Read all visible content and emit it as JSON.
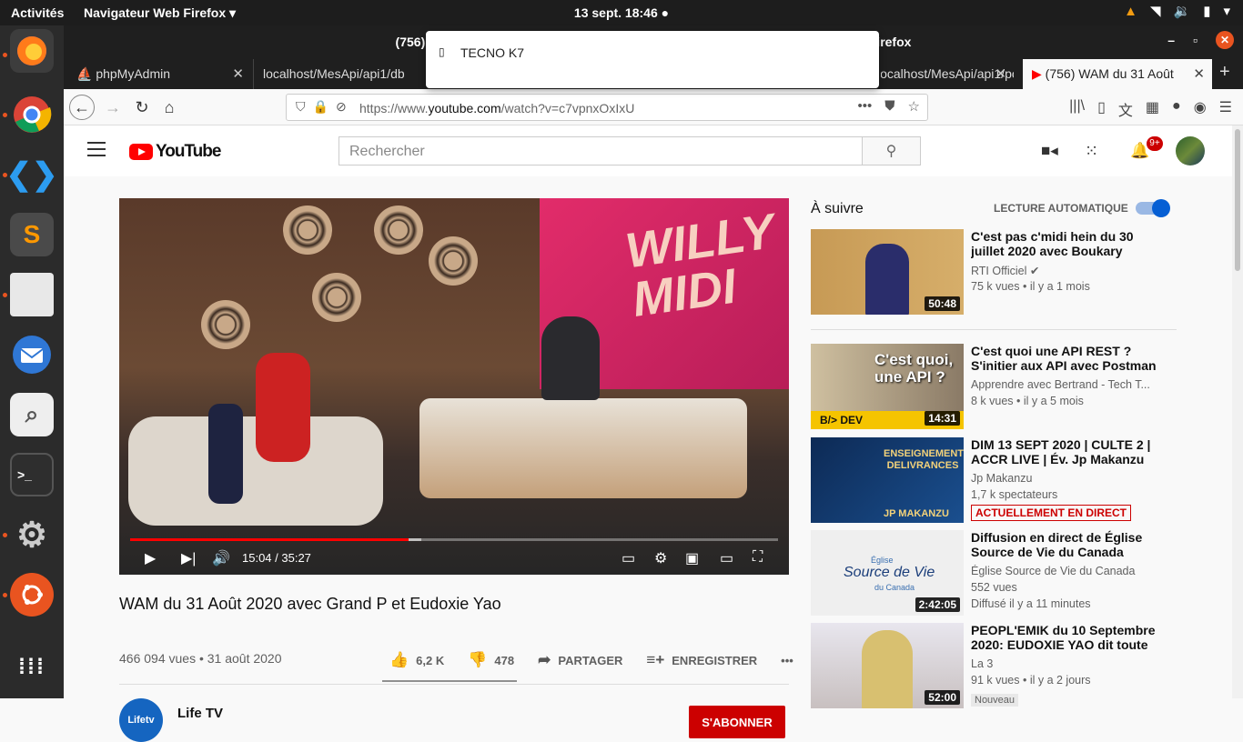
{
  "topbar": {
    "activities": "Activités",
    "app": "Navigateur Web Firefox ▾",
    "clock": "13 sept.  18:46 ●"
  },
  "window": {
    "title": "(756) WAM du 31 Août 2020 avec Grand P et Eudoxie Yao - YouTube — Mozilla Firefox"
  },
  "tabs": [
    {
      "label": "phpMyAdmin"
    },
    {
      "label": "localhost/MesApi/api1/db"
    },
    {
      "label": "localhost/MesApi/api1/po"
    },
    {
      "label": "(756) WAM du 31 Août"
    }
  ],
  "popup": {
    "label": "TECNO K7"
  },
  "url": {
    "prefix": "https://www.",
    "domain": "youtube.com",
    "path": "/watch?v=c7vpnxOxIxU"
  },
  "youtube": {
    "logo": "YouTube",
    "search_placeholder": "Rechercher",
    "notif_count": "9+",
    "video": {
      "time": "15:04 / 35:27",
      "progress": 0.43,
      "buffered": 0.45,
      "brand": "WILLY\nMIDI"
    },
    "title": "WAM du 31 Août 2020 avec Grand P et Eudoxie Yao",
    "stats": "466 094 vues • 31 août 2020",
    "likes": "6,2 K",
    "dislikes": "478",
    "share": "PARTAGER",
    "save": "ENREGISTRER",
    "more": "•••",
    "channel": {
      "logo": "Lifetv",
      "name": "Life TV"
    },
    "subscribe": "S'ABONNER",
    "up_next": "À suivre",
    "autoplay": "LECTURE AUTOMATIQUE",
    "recs": [
      {
        "title": "C'est pas c'midi hein du 30 juillet 2020 avec Boukary",
        "channel": "RTI Officiel ✔",
        "meta": "75 k vues • il y a 1 mois",
        "duration": "50:48"
      },
      {
        "title": "C'est quoi une API REST ? S'initier aux API avec Postman !",
        "channel": "Apprendre avec Bertrand - Tech T...",
        "meta": "8 k vues • il y a 5 mois",
        "duration": "14:31",
        "thumb_text": "C'est quoi, une API ?",
        "thumb_sub": "B/> DEV"
      },
      {
        "title": "DIM 13 SEPT 2020 | CULTE 2 | ACCR LIVE | Év. Jp Makanzu o...",
        "channel": "Jp Makanzu",
        "meta": "1,7 k spectateurs",
        "badge": "ACTUELLEMENT EN DIRECT",
        "thumb_text": "ENSEIGNEMENTS DELIVRANCES",
        "thumb_sub": "JP MAKANZU"
      },
      {
        "title": "Diffusion en direct de Église Source de Vie du Canada",
        "channel": "Église Source de Vie du Canada",
        "meta": "552 vues",
        "meta2": "Diffusé il y a 11 minutes",
        "duration": "2:42:05",
        "thumb_text": "Source de Vie",
        "thumb_small": "Église",
        "thumb_small2": "du Canada"
      },
      {
        "title": "PEOPL'EMIK du 10 Septembre 2020: EUDOXIE YAO dit toute l...",
        "channel": "La 3",
        "meta": "91 k vues • il y a 2 jours",
        "duration": "52:00",
        "badge": "Nouveau"
      }
    ]
  }
}
